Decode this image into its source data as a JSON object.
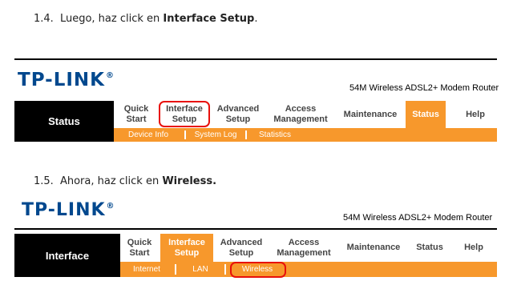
{
  "step1": {
    "number": "1.4.",
    "text": "Luego, haz click en ",
    "bold": "Interface Setup",
    "end": "."
  },
  "step2": {
    "number": "1.5.",
    "text": "Ahora, haz click en ",
    "bold": "Wireless."
  },
  "screen1": {
    "logo": "TP-LINK",
    "logo_mark": "®",
    "model": "54M Wireless ADSL2+ Modem Router",
    "section": "Status",
    "tabs": [
      "Quick\nStart",
      "Interface\nSetup",
      "Advanced\nSetup",
      "Access\nManagement",
      "Maintenance",
      "Status",
      "Help"
    ],
    "active_tab": "Status",
    "highlighted_tab": "Interface\nSetup",
    "subtabs": [
      "Device Info",
      "System Log",
      "Statistics"
    ]
  },
  "screen2": {
    "logo": "TP-LINK",
    "logo_mark": "®",
    "model": "54M Wireless ADSL2+ Modem Router",
    "section": "Interface",
    "tabs": [
      "Quick\nStart",
      "Interface\nSetup",
      "Advanced\nSetup",
      "Access\nManagement",
      "Maintenance",
      "Status",
      "Help"
    ],
    "active_tab": "Interface\nSetup",
    "subtabs": [
      "Internet",
      "LAN",
      "Wireless"
    ],
    "highlighted_subtab": "Wireless"
  },
  "colors": {
    "accent": "#f7982c",
    "logo": "#00488e",
    "highlight": "#e8100c",
    "side": "#000000"
  }
}
